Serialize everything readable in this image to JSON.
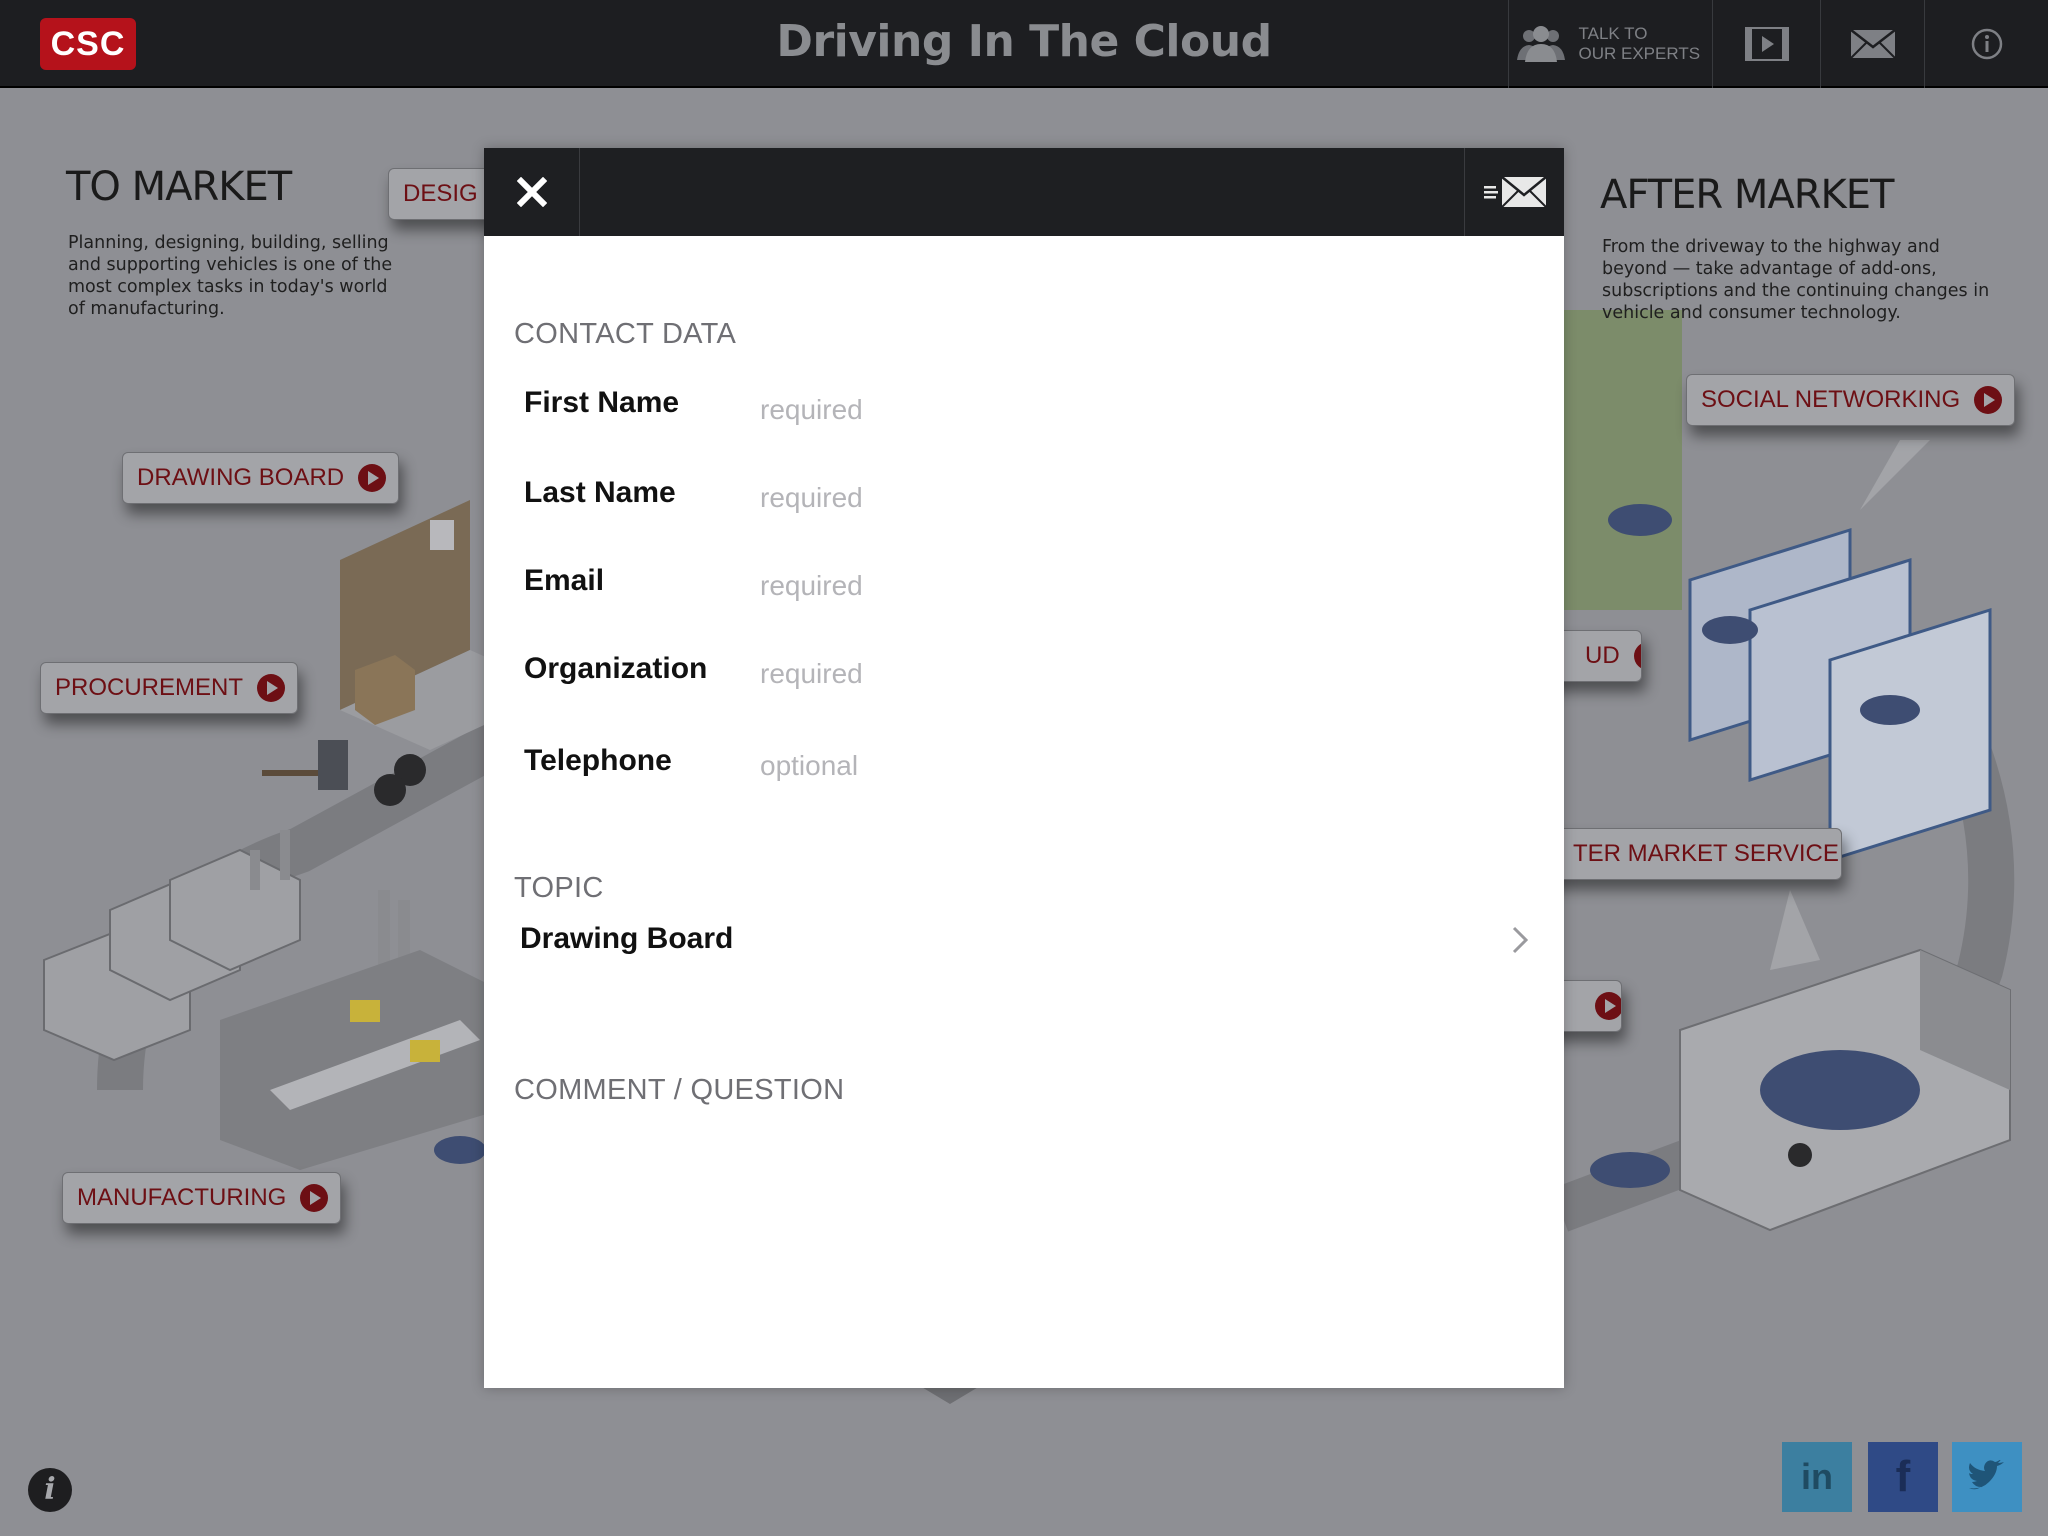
{
  "header": {
    "logo_text": "CSC",
    "title": "Driving In The Cloud",
    "experts_label_line1": "TALK TO",
    "experts_label_line2": "OUR EXPERTS",
    "icons": [
      "experts-icon",
      "video-icon",
      "mail-icon",
      "info-icon"
    ]
  },
  "background": {
    "to_market": {
      "title": "TO MARKET",
      "description": "Planning, designing, building, selling and supporting vehicles is one of the most complex tasks in today's world of manufacturing."
    },
    "after_market": {
      "title": "AFTER MARKET",
      "description": "From the driveway to the highway and beyond — take advantage of add-ons, subscriptions and the continuing changes in vehicle and consumer technology."
    },
    "pills": {
      "design": "DESIG",
      "drawing_board": "DRAWING BOARD",
      "procurement": "PROCUREMENT",
      "manufacturing": "MANUFACTURING",
      "social_networking": "SOCIAL NETWORKING",
      "cloud": "UD",
      "after_market_service": "TER MARKET SERVICE"
    },
    "social": [
      "in",
      "f",
      "twitter-icon"
    ],
    "accent": "#6d0f14"
  },
  "modal": {
    "contact_heading": "CONTACT DATA",
    "fields": [
      {
        "label": "First Name",
        "placeholder": "required"
      },
      {
        "label": "Last Name",
        "placeholder": "required"
      },
      {
        "label": "Email",
        "placeholder": "required"
      },
      {
        "label": "Organization",
        "placeholder": "required"
      },
      {
        "label": "Telephone",
        "placeholder": "optional"
      }
    ],
    "topic_heading": "TOPIC",
    "topic_value": "Drawing Board",
    "comment_heading": "COMMENT / QUESTION",
    "comment_value": ""
  }
}
